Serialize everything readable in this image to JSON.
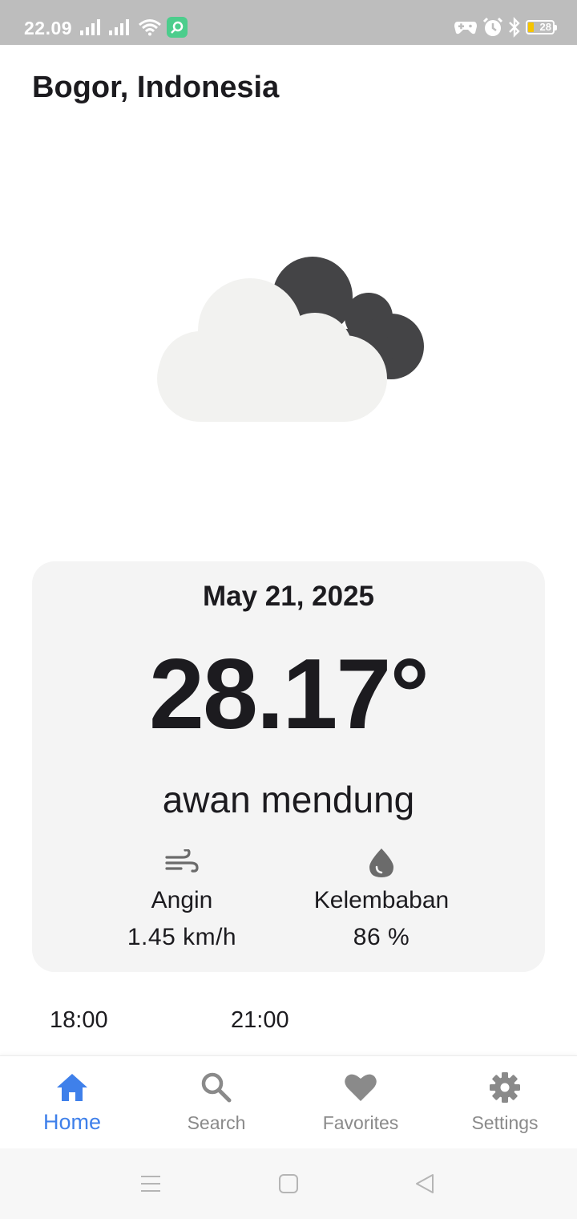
{
  "status_bar": {
    "time": "22.09",
    "battery_level": "28",
    "icons": [
      "signal-icon",
      "signal-icon",
      "wifi-icon",
      "app-notification-icon",
      "game-mode-icon",
      "alarm-icon",
      "bluetooth-icon",
      "battery-icon"
    ]
  },
  "header": {
    "location": "Bogor, Indonesia"
  },
  "weather": {
    "illustration": "cloudy-icon",
    "date": "May 21, 2025",
    "temperature": "28.17°",
    "condition": "awan mendung",
    "wind": {
      "icon": "wind-icon",
      "label": "Angin",
      "value": "1.45 km/h"
    },
    "humidity": {
      "icon": "water-drop-icon",
      "label": "Kelembaban",
      "value": "86 %"
    }
  },
  "forecast": {
    "times": [
      "18:00",
      "21:00"
    ]
  },
  "bottom_nav": {
    "items": [
      {
        "label": "Home",
        "icon": "home-icon",
        "active": true
      },
      {
        "label": "Search",
        "icon": "search-icon",
        "active": false
      },
      {
        "label": "Favorites",
        "icon": "heart-icon",
        "active": false
      },
      {
        "label": "Settings",
        "icon": "gear-icon",
        "active": false
      }
    ]
  },
  "colors": {
    "accent": "#3f80ea",
    "inactive": "#8a8a8a",
    "card_background": "#f4f4f4",
    "status_bar": "#bdbdbd",
    "text": "#1c1b1f"
  }
}
